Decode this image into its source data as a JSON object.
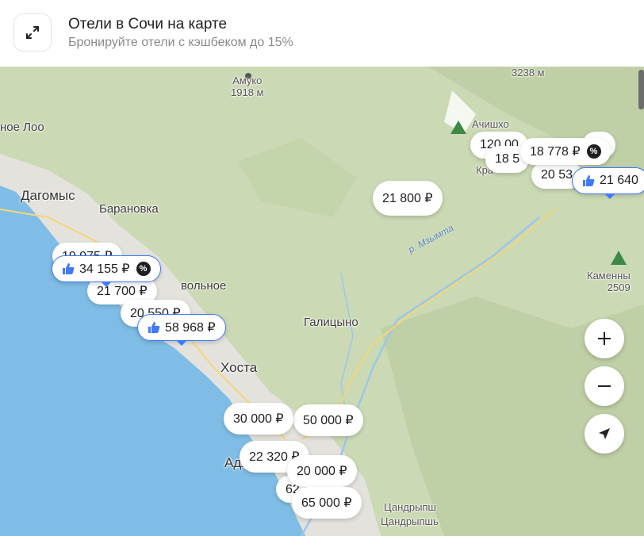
{
  "header": {
    "title": "Отели в Сочи на карте",
    "subtitle": "Бронируйте отели с кэшбеком до 15%"
  },
  "map": {
    "places": {
      "amuko": "Амуко",
      "amuko_alt": "1918 м",
      "peak_top": "3238 м",
      "noe_loo": "ное Лоо",
      "dagomys": "Дагомыс",
      "baranovka": "Барановка",
      "volnoe": "вольное",
      "galitsyno": "Галицыно",
      "khosta": "Хоста",
      "adler": "Адле",
      "achishkho": "Ачишхо",
      "kra": "Кра",
      "kamennyi": "Каменны",
      "kamennyi_alt": "2509",
      "tsandrypsh1": "Цандрыпш",
      "tsandrypsh2": "Цандрыпшь",
      "river": "р. Мзымта"
    },
    "pins": [
      {
        "price": "21 800 ₽"
      },
      {
        "price": "120 00"
      },
      {
        "price": "18 778 ₽"
      },
      {
        "price": "18 5"
      },
      {
        "price": "20 53"
      },
      {
        "price": "21 640"
      },
      {
        "price": "00"
      },
      {
        "price": "19 975 ₽"
      },
      {
        "price": "34 155 ₽"
      },
      {
        "price": "21 700 ₽"
      },
      {
        "price": "20 550 ₽"
      },
      {
        "price": "58 968 ₽"
      },
      {
        "price": "30 000 ₽"
      },
      {
        "price": "50 000 ₽"
      },
      {
        "price": "22 320 ₽"
      },
      {
        "price": "20 000 ₽"
      },
      {
        "price": "62 ₽"
      },
      {
        "price": "65 000 ₽"
      }
    ],
    "badges": {
      "percent": "%"
    }
  },
  "colors": {
    "sea": "#7fbde6",
    "land": "#cbd9b4",
    "promo_blue": "#3f79ff"
  }
}
